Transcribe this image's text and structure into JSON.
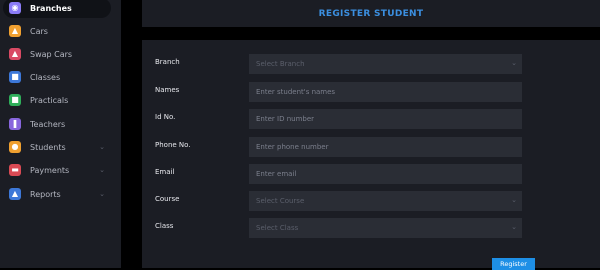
{
  "sidebar": {
    "items": [
      {
        "label": "Branches",
        "icon": "branches-icon",
        "color": "#8b7cf6",
        "active": true,
        "chevron": false
      },
      {
        "label": "Cars",
        "icon": "car-icon",
        "color": "#f0a030",
        "active": false,
        "chevron": false
      },
      {
        "label": "Swap Cars",
        "icon": "swap-icon",
        "color": "#d94a64",
        "active": false,
        "chevron": false
      },
      {
        "label": "Classes",
        "icon": "classes-icon",
        "color": "#3d78d8",
        "active": false,
        "chevron": false
      },
      {
        "label": "Practicals",
        "icon": "practicals-icon",
        "color": "#2fae5a",
        "active": false,
        "chevron": false
      },
      {
        "label": "Teachers",
        "icon": "teachers-icon",
        "color": "#8866dd",
        "active": false,
        "chevron": false
      },
      {
        "label": "Students",
        "icon": "students-icon",
        "color": "#f0a030",
        "active": false,
        "chevron": true
      },
      {
        "label": "Payments",
        "icon": "payments-icon",
        "color": "#d94a54",
        "active": false,
        "chevron": true
      },
      {
        "label": "Reports",
        "icon": "reports-icon",
        "color": "#3d78d8",
        "active": false,
        "chevron": true
      }
    ]
  },
  "header": {
    "title": "REGISTER STUDENT"
  },
  "form": {
    "branch": {
      "label": "Branch",
      "placeholder": "Select Branch"
    },
    "names": {
      "label": "Names",
      "placeholder": "Enter student's names"
    },
    "idno": {
      "label": "Id No.",
      "placeholder": "Enter ID number"
    },
    "phone": {
      "label": "Phone No.",
      "placeholder": "Enter phone number"
    },
    "email": {
      "label": "Email",
      "placeholder": "Enter email"
    },
    "course": {
      "label": "Course",
      "placeholder": "Select Course"
    },
    "class": {
      "label": "Class",
      "placeholder": "Select Class"
    },
    "submit_label": "Register"
  },
  "colors": {
    "accent": "#1e8fe6",
    "title": "#3b8fe0",
    "panel": "#1b1d24",
    "input": "#2a2d35"
  }
}
